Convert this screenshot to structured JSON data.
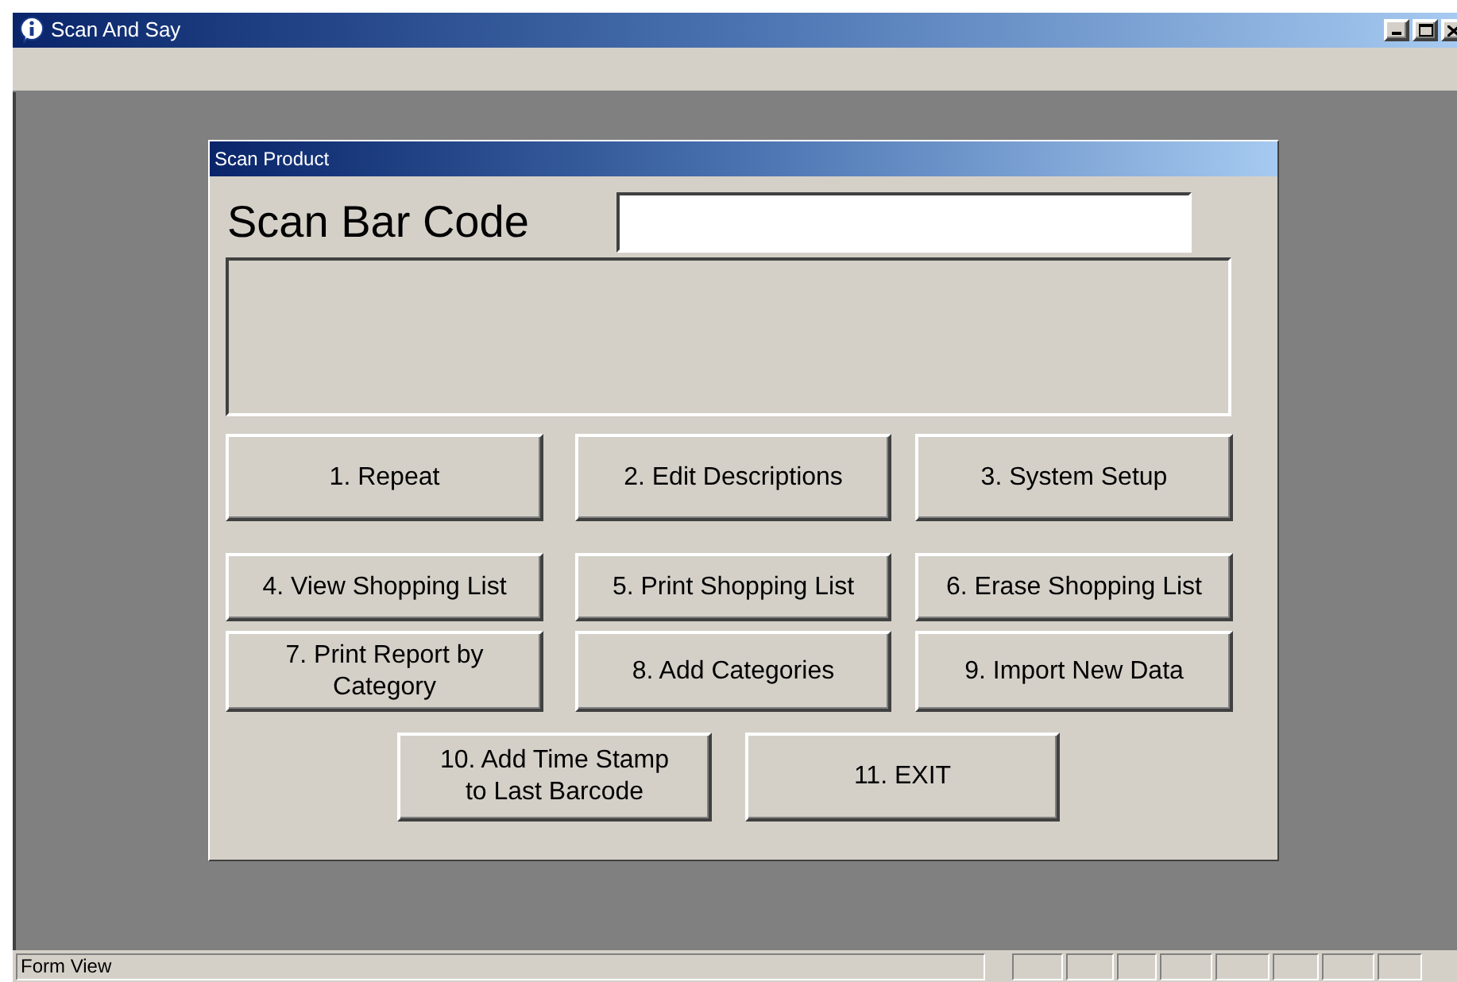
{
  "window": {
    "title": "Scan And Say"
  },
  "form": {
    "title": "Scan Product",
    "scan_label": "Scan Bar Code",
    "button_rows": [
      {
        "buttons": [
          "1. Repeat",
          "2. Edit Descriptions",
          "3. System Setup"
        ]
      },
      {
        "buttons": [
          "4. View Shopping List",
          "5. Print Shopping List",
          "6. Erase Shopping List"
        ]
      },
      {
        "buttons": [
          "7. Print Report by Category",
          "8. Add Categories",
          "9. Import New Data"
        ]
      },
      {
        "buttons": [
          "10. Add Time Stamp to Last Barcode",
          "11. EXIT"
        ]
      }
    ]
  },
  "status_bar": {
    "text": "Form View"
  }
}
